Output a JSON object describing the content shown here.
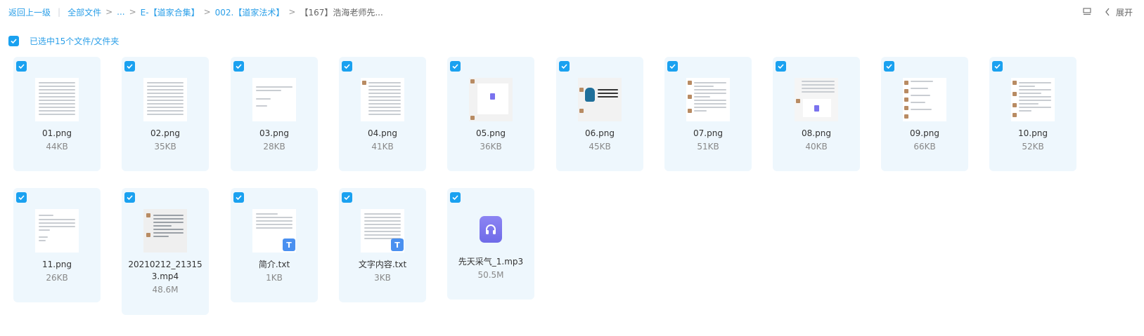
{
  "breadcrumb": {
    "back": "返回上一级",
    "root": "全部文件",
    "ellipsis": "...",
    "level1": "E-【道家合集】",
    "level2": "002.【道家法术】",
    "current": "【167】浩海老师先..."
  },
  "toolbar": {
    "expand_label": "展开"
  },
  "selection": {
    "label": "已选中15个文件/文件夹"
  },
  "files": [
    {
      "name": "01.png",
      "size": "44KB",
      "kind": "image"
    },
    {
      "name": "02.png",
      "size": "35KB",
      "kind": "image"
    },
    {
      "name": "03.png",
      "size": "28KB",
      "kind": "image"
    },
    {
      "name": "04.png",
      "size": "41KB",
      "kind": "image"
    },
    {
      "name": "05.png",
      "size": "36KB",
      "kind": "image"
    },
    {
      "name": "06.png",
      "size": "45KB",
      "kind": "image"
    },
    {
      "name": "07.png",
      "size": "51KB",
      "kind": "image"
    },
    {
      "name": "08.png",
      "size": "40KB",
      "kind": "image"
    },
    {
      "name": "09.png",
      "size": "66KB",
      "kind": "image"
    },
    {
      "name": "10.png",
      "size": "52KB",
      "kind": "image"
    },
    {
      "name": "11.png",
      "size": "26KB",
      "kind": "image"
    },
    {
      "name": "20210212_213153.mp4",
      "size": "48.6M",
      "kind": "video"
    },
    {
      "name": "简介.txt",
      "size": "1KB",
      "kind": "text",
      "badge": "T"
    },
    {
      "name": "文字内容.txt",
      "size": "3KB",
      "kind": "text",
      "badge": "T"
    },
    {
      "name": "先天采气_1.mp3",
      "size": "50.5M",
      "kind": "audio"
    }
  ],
  "colors": {
    "accent": "#2b9fe8",
    "checkbox": "#1aa1f0",
    "card_bg": "#eef7fd"
  },
  "icons": {
    "checkbox": "check-icon",
    "list_view": "list-view-icon",
    "expand": "chevron-left-icon",
    "text_badge": "text-file-icon",
    "audio": "headphones-icon"
  }
}
